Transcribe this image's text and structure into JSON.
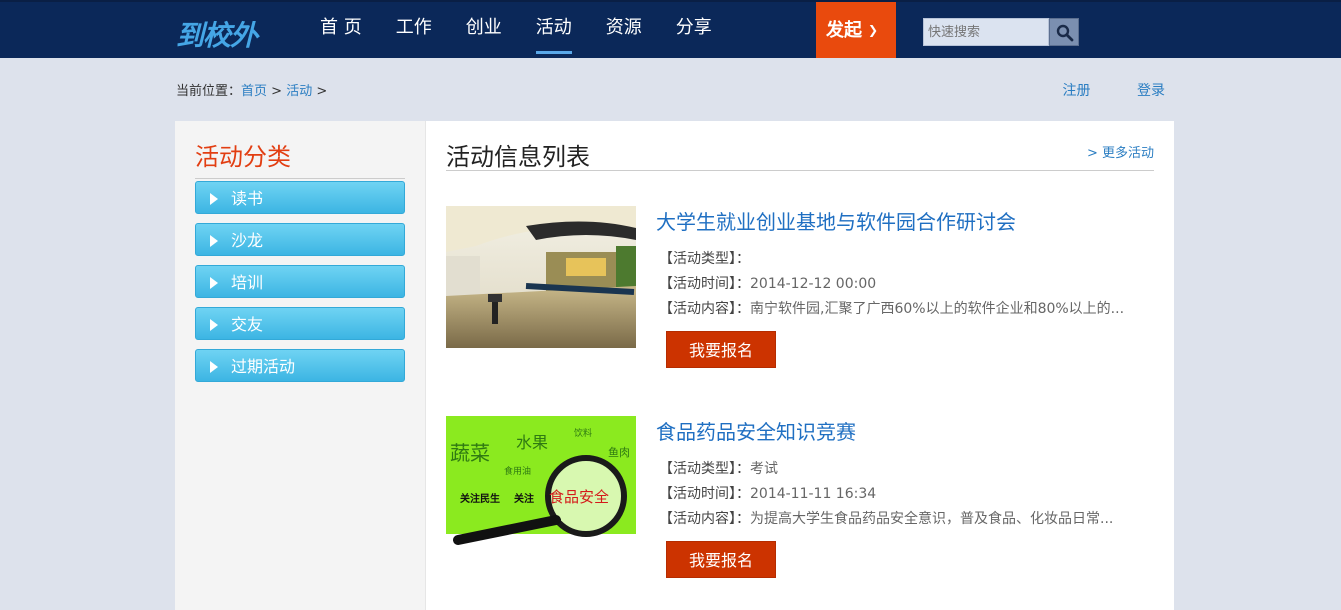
{
  "header": {
    "logo": "到校外",
    "nav": [
      "首 页",
      "工作",
      "创业",
      "活动",
      "资源",
      "分享"
    ],
    "active_nav": "活动",
    "launch_label": "发起",
    "search_placeholder": "快速搜索"
  },
  "breadcrumb": {
    "prefix": "当前位置：",
    "items": [
      "首页",
      "活动"
    ],
    "sep": ">"
  },
  "account": {
    "register": "注册",
    "login": "登录"
  },
  "sidebar": {
    "title": "活动分类",
    "categories": [
      "读书",
      "沙龙",
      "培训",
      "交友",
      "过期活动"
    ]
  },
  "main": {
    "title": "活动信息列表",
    "more": "> 更多活动",
    "events": [
      {
        "title": "大学生就业创业基地与软件园合作研讨会",
        "type_label": "【活动类型】：",
        "type": "",
        "time_label": "【活动时间】：",
        "time": "2014-12-12 00:00",
        "content_label": "【活动内容】：",
        "content": "南宁软件园,汇聚了广西60%以上的软件企业和80%以上的...",
        "button": "我要报名"
      },
      {
        "title": "食品药品安全知识竞赛",
        "type_label": "【活动类型】：",
        "type": "考试",
        "time_label": "【活动时间】：",
        "time": "2014-11-11 16:34",
        "content_label": "【活动内容】：",
        "content": "为提高大学生食品药品安全意识，普及食品、化妆品日常...",
        "button": "我要报名",
        "image_text": [
          "蔬菜",
          "水果",
          "饮料",
          "鱼肉",
          "食用油",
          "关注民生",
          "关注",
          "食品安全"
        ]
      }
    ]
  }
}
